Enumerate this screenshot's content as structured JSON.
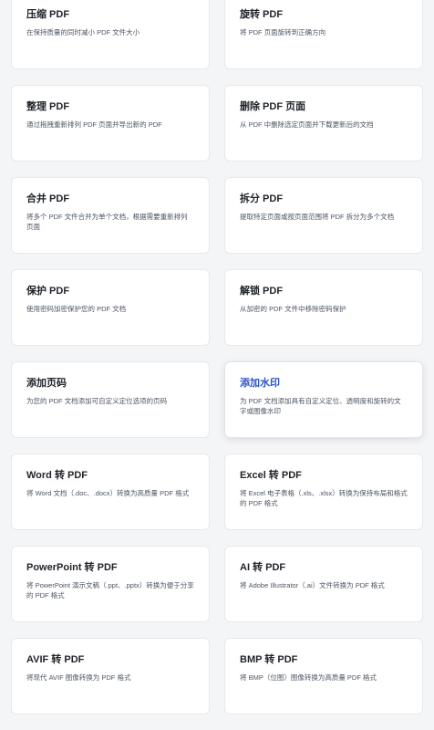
{
  "tools": [
    {
      "title": "压缩 PDF",
      "desc": "在保持质量的同时减小 PDF 文件大小"
    },
    {
      "title": "旋转 PDF",
      "desc": "将 PDF 页面旋转到正确方向"
    },
    {
      "title": "整理 PDF",
      "desc": "通过拖拽重新排列 PDF 页面并导出新的 PDF"
    },
    {
      "title": "删除 PDF 页面",
      "desc": "从 PDF 中删除选定页面并下载更新后的文档"
    },
    {
      "title": "合并 PDF",
      "desc": "将多个 PDF 文件合并为单个文档，根据需要重新排列页面"
    },
    {
      "title": "拆分 PDF",
      "desc": "提取特定页面或按页面范围将 PDF 拆分为多个文档"
    },
    {
      "title": "保护 PDF",
      "desc": "使用密码加密保护您的 PDF 文档"
    },
    {
      "title": "解锁 PDF",
      "desc": "从加密的 PDF 文件中移除密码保护"
    },
    {
      "title": "添加页码",
      "desc": "为您的 PDF 文档添加可自定义定位选项的页码"
    },
    {
      "title": "添加水印",
      "desc": "为 PDF 文档添加具有自定义定位、透明度和旋转的文字或图像水印"
    },
    {
      "title": "Word 转 PDF",
      "desc": "将 Word 文档（.doc、.docx）转换为高质量 PDF 格式"
    },
    {
      "title": "Excel 转 PDF",
      "desc": "将 Excel 电子表格（.xls、.xlsx）转换为保持布局和格式的 PDF 格式"
    },
    {
      "title": "PowerPoint 转 PDF",
      "desc": "将 PowerPoint 演示文稿（.ppt、.pptx）转换为便于分享的 PDF 格式"
    },
    {
      "title": "AI 转 PDF",
      "desc": "将 Adobe Illustrator（.ai）文件转换为 PDF 格式"
    },
    {
      "title": "AVIF 转 PDF",
      "desc": "将现代 AVIF 图像转换为 PDF 格式"
    },
    {
      "title": "BMP 转 PDF",
      "desc": "将 BMP（位图）图像转换为高质量 PDF 格式"
    }
  ]
}
